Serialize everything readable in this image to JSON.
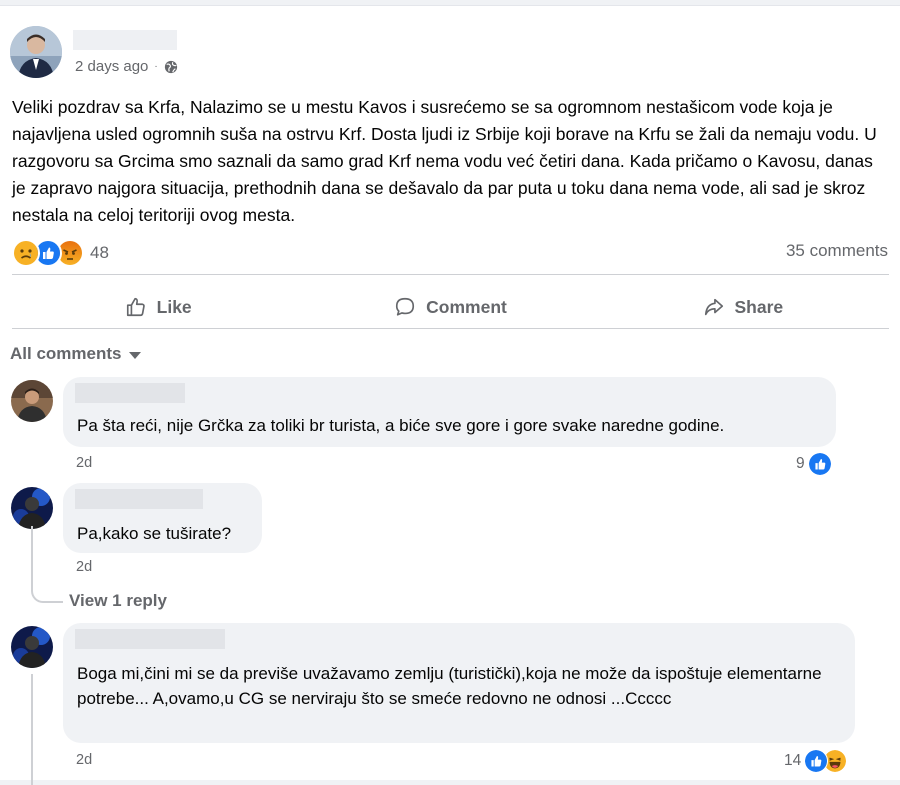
{
  "post": {
    "time": "2 days ago",
    "privacy_icon": "globe-icon",
    "text": "Veliki pozdrav sa Krfa, Nalazimo se u mestu Kavos i susrećemo se sa ogromnom nestašicom vode koja je najavljena usled ogromnih suša na ostrvu Krf. Dosta ljudi iz Srbije koji borave na Krfu se žali da nemaju vodu. U razgovoru sa Grcima smo saznali da samo grad Krf nema vodu već četiri dana. Kada pričamo o Kavosu, danas je zapravo najgora situacija, prethodnih dana se dešavalo da par puta u toku dana nema vode, ali sad je skroz nestala na celoj teritoriji ovog mesta.",
    "reaction_count": "48",
    "reaction_icons": [
      "sad-icon",
      "like-icon",
      "angry-icon"
    ],
    "comments_count": "35 comments"
  },
  "actions": {
    "like": "Like",
    "comment": "Comment",
    "share": "Share"
  },
  "comments_filter": "All comments",
  "comments": [
    {
      "text": "Pa šta reći, nije Grčka za toliki br turista, a biće sve gore i gore svake naredne godine.",
      "time": "2d",
      "reaction_count": "9"
    },
    {
      "text": "Pa,kako se tuširate?",
      "time": "2d",
      "view_replies": "View 1 reply"
    },
    {
      "text": "Boga mi,čini mi se da previše uvažavamo zemlju (turistički),koja ne može da ispoštuje elementarne potrebe... A,ovamo,u CG se nerviraju što se smeće redovno ne odnosi ...Ccccc",
      "time": "2d",
      "reaction_count": "14"
    }
  ],
  "colors": {
    "like_blue": "#1877f2",
    "secondary_text": "#65676b",
    "bubble_bg": "#f0f2f5"
  }
}
